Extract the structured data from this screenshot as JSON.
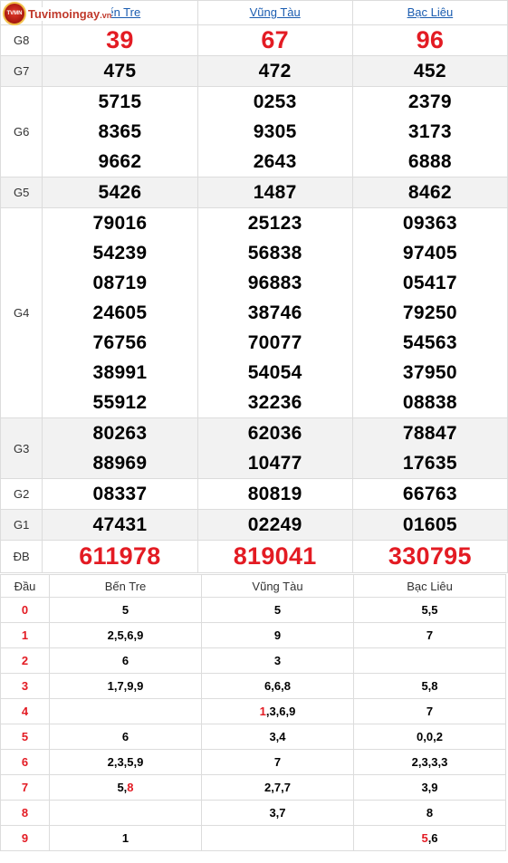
{
  "logo": {
    "badge": "TVMN",
    "name": "Tuvimoingay",
    "tld": ".vn"
  },
  "provinces": [
    "Bến Tre",
    "Vũng Tàu",
    "Bạc Liêu"
  ],
  "prizes": [
    {
      "label": "G8",
      "values": [
        [
          "39"
        ],
        [
          "67"
        ],
        [
          "96"
        ]
      ]
    },
    {
      "label": "G7",
      "values": [
        [
          "475"
        ],
        [
          "472"
        ],
        [
          "452"
        ]
      ]
    },
    {
      "label": "G6",
      "values": [
        [
          "5715",
          "8365",
          "9662"
        ],
        [
          "0253",
          "9305",
          "2643"
        ],
        [
          "2379",
          "3173",
          "6888"
        ]
      ]
    },
    {
      "label": "G5",
      "values": [
        [
          "5426"
        ],
        [
          "1487"
        ],
        [
          "8462"
        ]
      ]
    },
    {
      "label": "G4",
      "values": [
        [
          "79016",
          "54239",
          "08719",
          "24605",
          "76756",
          "38991",
          "55912"
        ],
        [
          "25123",
          "56838",
          "96883",
          "38746",
          "70077",
          "54054",
          "32236"
        ],
        [
          "09363",
          "97405",
          "05417",
          "79250",
          "54563",
          "37950",
          "08838"
        ]
      ]
    },
    {
      "label": "G3",
      "values": [
        [
          "80263",
          "88969"
        ],
        [
          "62036",
          "10477"
        ],
        [
          "78847",
          "17635"
        ]
      ]
    },
    {
      "label": "G2",
      "values": [
        [
          "08337"
        ],
        [
          "80819"
        ],
        [
          "66763"
        ]
      ]
    },
    {
      "label": "G1",
      "values": [
        [
          "47431"
        ],
        [
          "02249"
        ],
        [
          "01605"
        ]
      ]
    },
    {
      "label": "ĐB",
      "values": [
        [
          "611978"
        ],
        [
          "819041"
        ],
        [
          "330795"
        ]
      ]
    }
  ],
  "loto": {
    "head_label": "Đầu",
    "rows": [
      {
        "head": "0",
        "cells": [
          [
            {
              "t": "5"
            }
          ],
          [
            {
              "t": "5"
            }
          ],
          [
            {
              "t": "5,5"
            }
          ]
        ]
      },
      {
        "head": "1",
        "cells": [
          [
            {
              "t": "2,5,6,9"
            }
          ],
          [
            {
              "t": "9"
            }
          ],
          [
            {
              "t": "7"
            }
          ]
        ]
      },
      {
        "head": "2",
        "cells": [
          [
            {
              "t": "6"
            }
          ],
          [
            {
              "t": "3"
            }
          ],
          []
        ]
      },
      {
        "head": "3",
        "cells": [
          [
            {
              "t": "1,7,9,9"
            }
          ],
          [
            {
              "t": "6,6,8"
            }
          ],
          [
            {
              "t": "5,8"
            }
          ]
        ]
      },
      {
        "head": "4",
        "cells": [
          [],
          [
            {
              "t": "1",
              "hl": true
            },
            {
              "t": ",3,6,9"
            }
          ],
          [
            {
              "t": "7"
            }
          ]
        ]
      },
      {
        "head": "5",
        "cells": [
          [
            {
              "t": "6"
            }
          ],
          [
            {
              "t": "3,4"
            }
          ],
          [
            {
              "t": "0,0,2"
            }
          ]
        ]
      },
      {
        "head": "6",
        "cells": [
          [
            {
              "t": "2,3,5,9"
            }
          ],
          [
            {
              "t": "7"
            }
          ],
          [
            {
              "t": "2,3,3,3"
            }
          ]
        ]
      },
      {
        "head": "7",
        "cells": [
          [
            {
              "t": "5,"
            },
            {
              "t": "8",
              "hl": true
            }
          ],
          [
            {
              "t": "2,7,7"
            }
          ],
          [
            {
              "t": "3,9"
            }
          ]
        ]
      },
      {
        "head": "8",
        "cells": [
          [],
          [
            {
              "t": "3,7"
            }
          ],
          [
            {
              "t": "8"
            }
          ]
        ]
      },
      {
        "head": "9",
        "cells": [
          [
            {
              "t": "1"
            }
          ],
          [],
          [
            {
              "t": "5",
              "hl": true
            },
            {
              "t": ",6"
            }
          ]
        ]
      }
    ]
  },
  "colors": {
    "accent_red": "#e31b23",
    "link_blue": "#1a5cb0",
    "row_shade": "#f2f2f2"
  }
}
